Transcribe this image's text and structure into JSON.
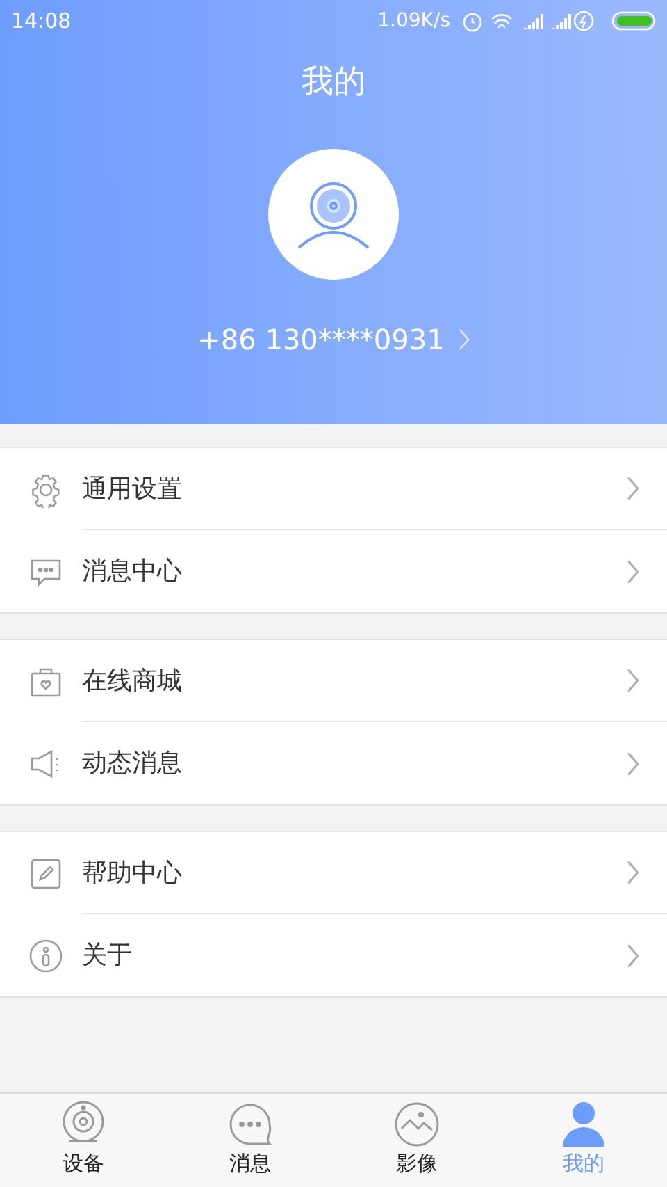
{
  "status_bar": {
    "time": "14:08",
    "speed": "1.09K/s"
  },
  "header": {
    "title": "我的",
    "phone": "+86 130****0931"
  },
  "menu_groups": [
    [
      {
        "kind": "settings",
        "label": "通用设置"
      },
      {
        "kind": "message",
        "label": "消息中心"
      }
    ],
    [
      {
        "kind": "shop",
        "label": "在线商城"
      },
      {
        "kind": "news",
        "label": "动态消息"
      }
    ],
    [
      {
        "kind": "help",
        "label": "帮助中心"
      },
      {
        "kind": "about",
        "label": "关于"
      }
    ]
  ],
  "tabs": [
    {
      "kind": "device",
      "label": "设备",
      "selected": false
    },
    {
      "kind": "message",
      "label": "消息",
      "selected": false
    },
    {
      "kind": "image",
      "label": "影像",
      "selected": false
    },
    {
      "kind": "me",
      "label": "我的",
      "selected": true
    }
  ]
}
